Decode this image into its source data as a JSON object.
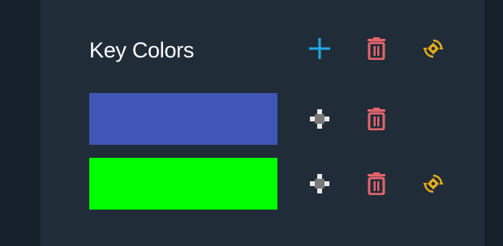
{
  "header": {
    "title": "Key Colors"
  },
  "colors": {
    "add_accent": "#1fa8e6",
    "delete_accent": "#e5646b",
    "reset_accent": "#e9ad1b",
    "move_light": "#e8e8e8",
    "move_dark": "#7a7a7a"
  },
  "icons": {
    "add": "plus-icon",
    "delete": "trash-icon",
    "reset": "gear-refresh-icon",
    "move": "move-arrows-icon"
  },
  "key_colors": [
    {
      "hex": "#4055b5",
      "has_reset": false
    },
    {
      "hex": "#00ff00",
      "has_reset": true
    }
  ]
}
